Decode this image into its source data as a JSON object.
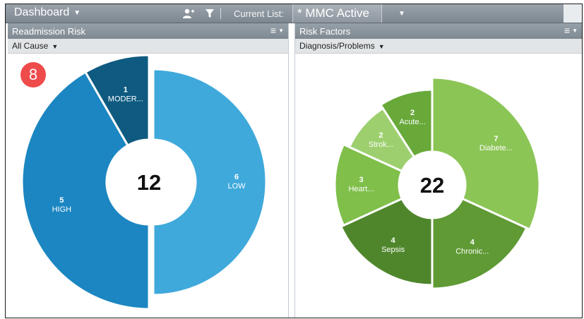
{
  "header": {
    "title": "Dashboard",
    "current_list_label": "Current List:",
    "current_list_value": "* MMC Active"
  },
  "panels": [
    {
      "title": "Readmission Risk",
      "filter": "All Cause",
      "badge": "8"
    },
    {
      "title": "Risk Factors",
      "filter": "Diagnosis/Problems"
    }
  ],
  "chart_data": [
    {
      "type": "pie",
      "title": "",
      "total": "12",
      "slices": [
        {
          "count": 6,
          "label": "LOW",
          "color": "#3fa9db"
        },
        {
          "count": 5,
          "label": "HIGH",
          "color": "#1b86c1"
        },
        {
          "count": 1,
          "label": "MODER...",
          "color": "#0e5a80"
        }
      ]
    },
    {
      "type": "pie",
      "title": "",
      "total": "22",
      "slices": [
        {
          "count": 7,
          "label": "Diabete...",
          "color": "#8bc556"
        },
        {
          "count": 4,
          "label": "Chronic...",
          "color": "#5f9a35"
        },
        {
          "count": 4,
          "label": "Sepsis",
          "color": "#4f862c"
        },
        {
          "count": 3,
          "label": "Heart...",
          "color": "#7fbf4a"
        },
        {
          "count": 2,
          "label": "Strok...",
          "color": "#9dcf6f"
        },
        {
          "count": 2,
          "label": "Acute...",
          "color": "#68a93a"
        }
      ]
    }
  ]
}
